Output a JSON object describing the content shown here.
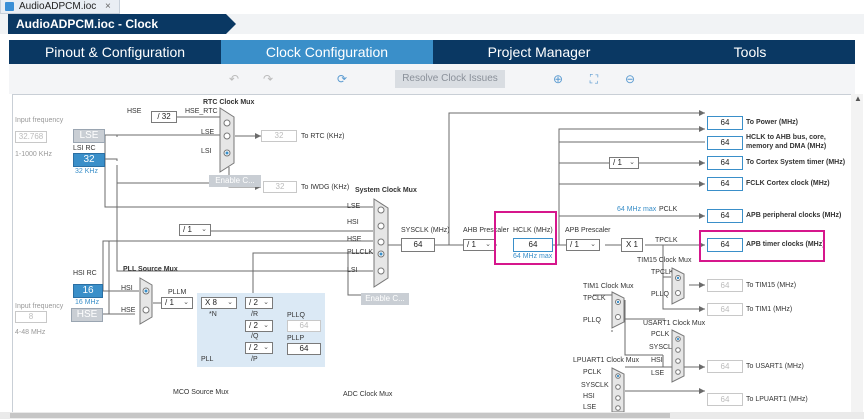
{
  "file_tab": {
    "name": "AudioADPCM.ioc",
    "close": "×"
  },
  "breadcrumb": {
    "label": "AudioADPCM.ioc - Clock Configuration"
  },
  "tabs": [
    "Pinout & Configuration",
    "Clock Configuration",
    "Project Manager",
    "Tools"
  ],
  "toolbar": {
    "resolve": "Resolve Clock Issues"
  },
  "left": {
    "input_freq_1": "Input frequency",
    "lse_value": "32.768",
    "lse_range": "1-1000 KHz",
    "lse": "LSE",
    "lsi_rc": "LSI RC",
    "lsi_value": "32",
    "lsi_khz": "32 KHz",
    "hsi_rc": "HSI RC",
    "hsi_value": "16",
    "hsi_mhz": "16 MHz",
    "input_freq_2": "Input frequency",
    "hse_value": "8",
    "hse_range": "4-48 MHz",
    "hse": "HSE"
  },
  "rtc": {
    "title": "RTC Clock Mux",
    "hse": "HSE",
    "div": "/ 32",
    "hse_rtc": "HSE_RTC",
    "lse": "LSE",
    "lsi": "LSI",
    "value": "32",
    "to_rtc": "To RTC (KHz)",
    "enable": "Enable C...",
    "iwdg_value": "32",
    "to_iwdg": "To IWDG (KHz)"
  },
  "sysmux": {
    "title": "System Clock Mux",
    "inputs": [
      "LSE",
      "HSI",
      "HSE",
      "PLLCLK",
      "LSI"
    ],
    "enable": "Enable C...",
    "sysclk_label": "SYSCLK (MHz)",
    "sysclk": "64",
    "pre_div": "/ 1"
  },
  "pll": {
    "src_title": "PLL Source Mux",
    "hsi": "HSI",
    "hse": "HSE",
    "pllm_label": "PLLM",
    "pllm": "/ 1",
    "n": "X 8",
    "n_label": "*N",
    "r_div": "/ 2",
    "r_label": "/R",
    "q_div": "/ 2",
    "q_label": "/Q",
    "p_div": "/ 2",
    "p_label": "/P",
    "pll": "PLL",
    "pllq_label": "PLLQ",
    "pllq": "64",
    "pllp_label": "PLLP",
    "pllp": "64",
    "top_div": "/ 2"
  },
  "ahb": {
    "prescaler_label": "AHB Prescaler",
    "prescaler": "/ 1",
    "hclk_label": "HCLK (MHz)",
    "hclk": "64",
    "hclk_max": "64 MHz max"
  },
  "apb": {
    "prescaler_label": "APB Prescaler",
    "prescaler": "/ 1",
    "max": "64 MHz max",
    "pclk": "PCLK",
    "mult": "X 1",
    "tpclk": "TPCLK"
  },
  "outputs": [
    {
      "value": "64",
      "label": "To Power (MHz)"
    },
    {
      "value": "64",
      "label": "HCLK to AHB bus, core, memory and DMA (MHz)"
    },
    {
      "value": "64",
      "label": "To Cortex System timer (MHz)"
    },
    {
      "value": "64",
      "label": "FCLK Cortex clock (MHz)"
    },
    {
      "value": "64",
      "label": "APB peripheral clocks (MHz)"
    },
    {
      "value": "64",
      "label": "APB timer clocks (MHz)"
    }
  ],
  "cortex_div": "/ 1",
  "tim15": {
    "title": "TIM15 Clock Mux",
    "tpclk": "TPCLK",
    "pllq": "PLLQ",
    "value": "64",
    "label": "To TIM15 (MHz)"
  },
  "tim1": {
    "title": "TIM1 Clock Mux",
    "tpclk": "TPCLK",
    "pllq": "PLLQ",
    "value": "64",
    "label": "To TIM1 (MHz)"
  },
  "usart1": {
    "title": "USART1 Clock Mux",
    "pclk": "PCLK",
    "sysclk": "SYSCLK",
    "hsi": "HSI",
    "lse": "LSE",
    "value": "64",
    "label": "To USART1 (MHz)"
  },
  "lpuart1": {
    "title": "LPUART1 Clock Mux",
    "pclk": "PCLK",
    "sysclk": "SYSCLK",
    "hsi": "HSI",
    "lse": "LSE",
    "value": "64",
    "label": "To LPUART1 (MHz)"
  },
  "mco": {
    "title": "MCO Source Mux"
  },
  "adc": {
    "title": "ADC Clock Mux"
  },
  "colors": {
    "navy": "#0a3863",
    "accent": "#3a8fc9",
    "highlight": "#d6168c"
  }
}
